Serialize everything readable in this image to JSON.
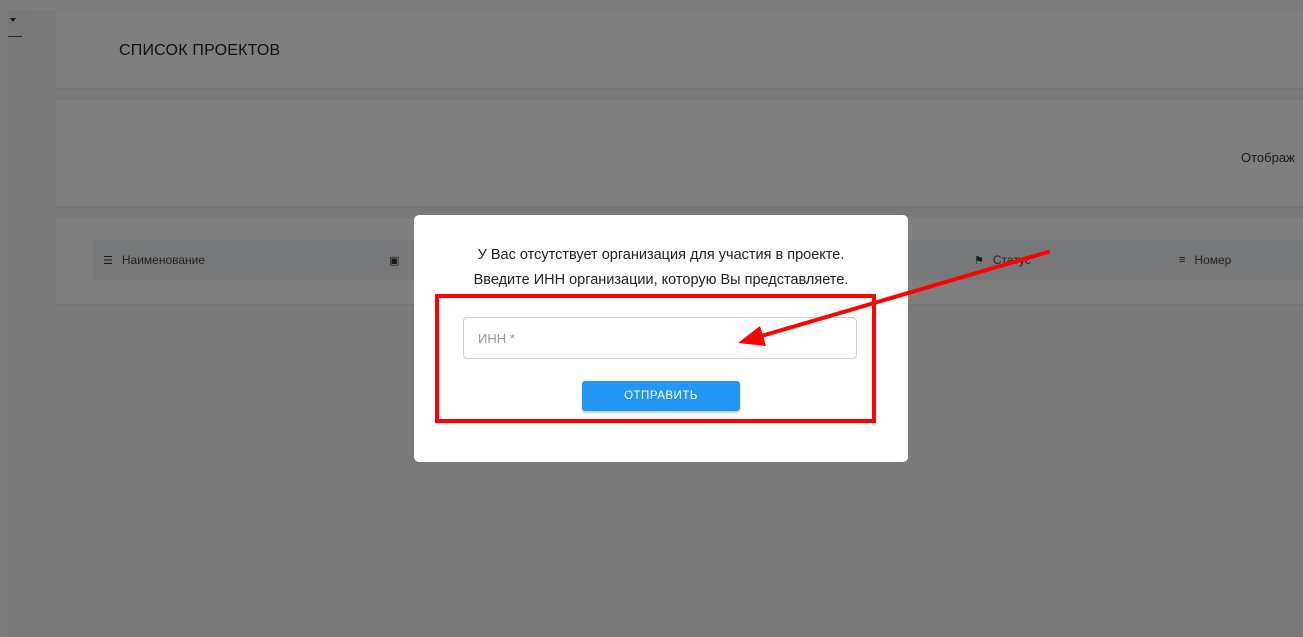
{
  "page": {
    "title": "СПИСОК ПРОЕКТОВ",
    "display_label": "Отображ"
  },
  "table": {
    "columns": [
      {
        "label": "Наименование",
        "icon": "list-icon"
      },
      {
        "label": "",
        "icon": "calendar-icon"
      },
      {
        "label": "Статус",
        "icon": "flag-icon"
      },
      {
        "label": "Номер",
        "icon": "numbered-list-icon"
      }
    ]
  },
  "modal": {
    "message_line1": "У Вас отсутствует организация для участия в проекте.",
    "message_line2": "Введите ИНН организации, которую Вы представляете.",
    "inn_placeholder": "ИНН *",
    "inn_value": "",
    "submit_label": "ОТПРАВИТЬ"
  },
  "annotation": {
    "highlight_color": "#ff0000",
    "button_color": "#2196f3"
  }
}
